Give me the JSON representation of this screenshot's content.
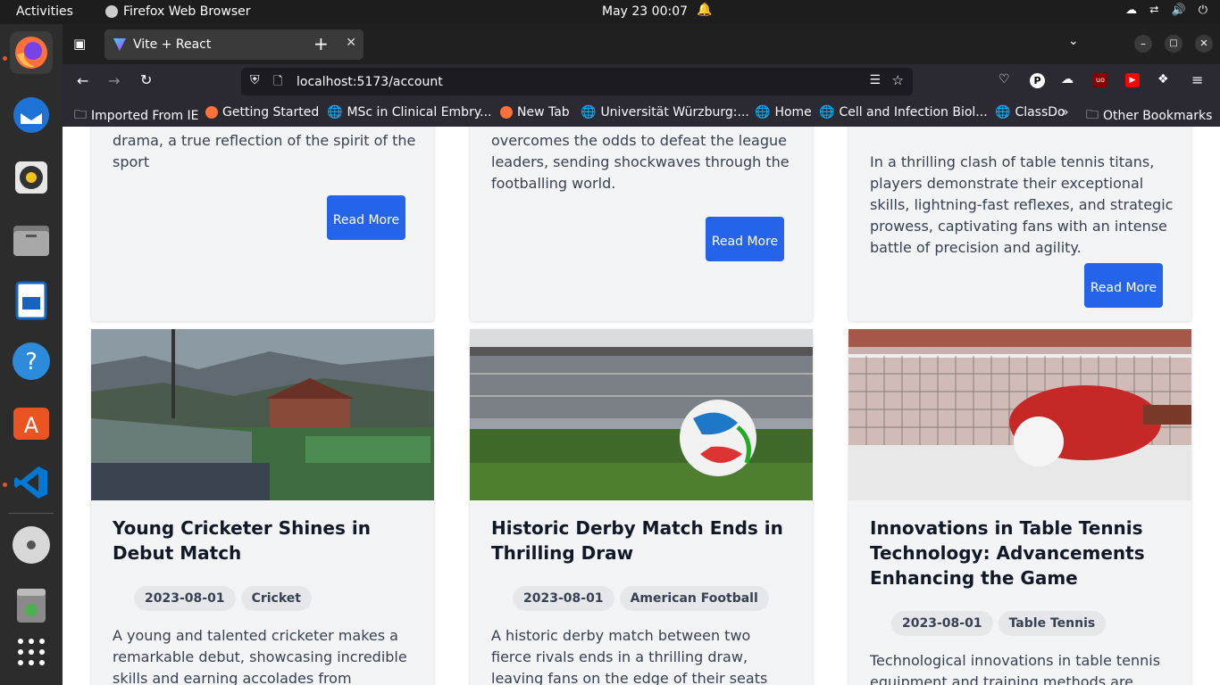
{
  "system": {
    "activities": "Activities",
    "app_name": "Firefox Web Browser",
    "clock": "May 23  00:07"
  },
  "browser": {
    "tab_title": "Vite + React",
    "url": "localhost:5173/account",
    "bookmarks": [
      "Imported From IE",
      "Getting Started",
      "MSc in Clinical Embry...",
      "New Tab",
      "Universität Würzburg:...",
      "Home",
      "Cell and Infection Biol...",
      "ClassDo",
      "Other Bookmarks"
    ]
  },
  "top_cards": [
    {
      "text": "drama, a true reflection of the spirit of the sport",
      "button": "Read More"
    },
    {
      "text": "overcomes the odds to defeat the league leaders, sending shockwaves through the footballing world.",
      "button": "Read More"
    },
    {
      "text": "In a thrilling clash of table tennis titans, players demonstrate their exceptional skills, lightning-fast reflexes, and strategic prowess, captivating fans with an intense battle of precision and agility.",
      "button": "Read More"
    }
  ],
  "cards": [
    {
      "title": "Young Cricketer Shines in Debut Match",
      "date": "2023-08-01",
      "category": "Cricket",
      "text": "A young and talented cricketer makes a remarkable debut, showcasing incredible skills and earning accolades from cricketing"
    },
    {
      "title": "Historic Derby Match Ends in Thrilling Draw",
      "date": "2023-08-01",
      "category": "American Football",
      "text": "A historic derby match between two fierce rivals ends in a thrilling draw, leaving fans on the edge of their seats and craving for more."
    },
    {
      "title": "Innovations in Table Tennis Technology: Advancements Enhancing the Game",
      "date": "2023-08-01",
      "category": "Table Tennis",
      "text": "Technological innovations in table tennis equipment and training methods are"
    }
  ]
}
